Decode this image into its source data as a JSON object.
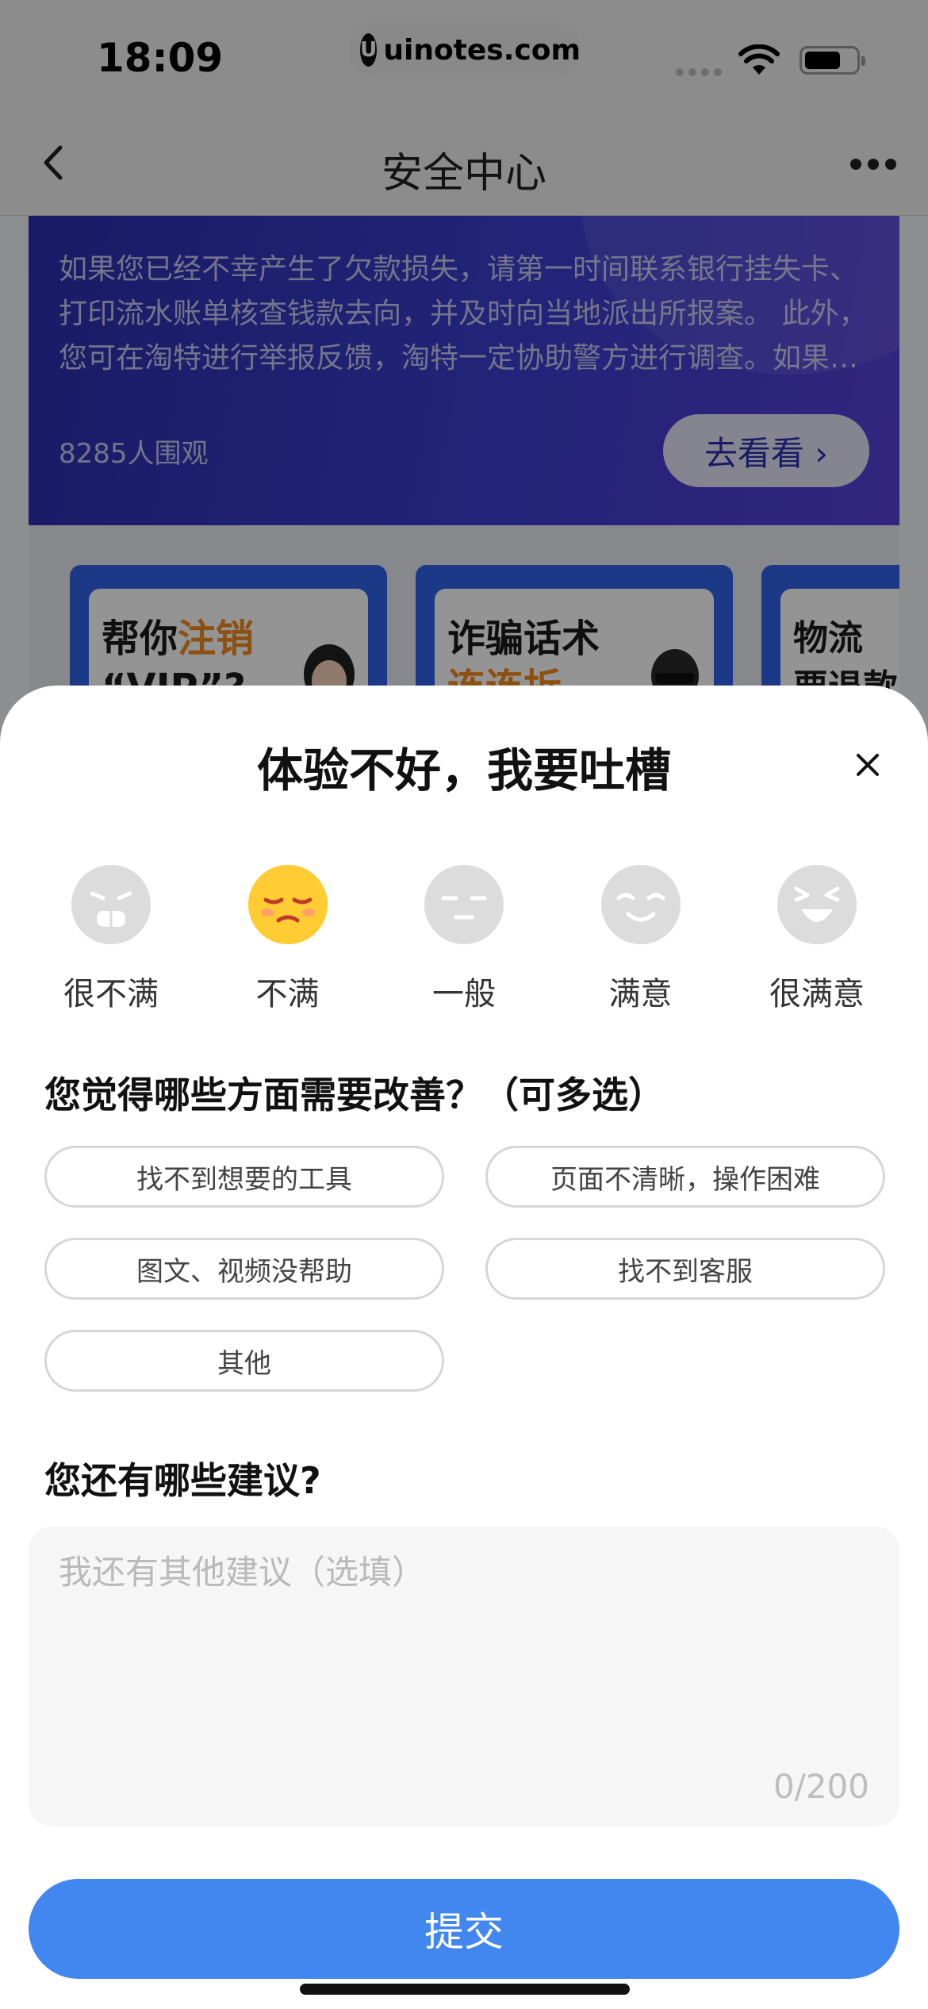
{
  "status_bar": {
    "time": "18:09",
    "url": "uinotes.com",
    "url_logo": "U"
  },
  "nav": {
    "title": "安全中心"
  },
  "promo": {
    "text": "如果您已经不幸产生了欠款损失，请第一时间联系银行挂失卡、打印流水账单核查钱款去向，并及时向当地派出所报案。 此外，您可在淘特进行举报反馈，淘特一定协助警方进行调查。如果…",
    "views": "8285人围观",
    "button_label": "去看看 ›"
  },
  "topic_cards": [
    {
      "line1_prefix": "帮你",
      "line1_highlight": "注销",
      "line2": "“VIP”?"
    },
    {
      "line1": "诈骗话术",
      "line2_highlight": "连连拆"
    },
    {
      "line1": "物流",
      "line2": "要退款"
    }
  ],
  "sheet": {
    "title": "体验不好，我要吐槽",
    "ratings": [
      {
        "label": "很不满",
        "icon": "very-unsatisfied-face-icon"
      },
      {
        "label": "不满",
        "icon": "unsatisfied-face-icon"
      },
      {
        "label": "一般",
        "icon": "neutral-face-icon"
      },
      {
        "label": "满意",
        "icon": "satisfied-face-icon"
      },
      {
        "label": "很满意",
        "icon": "very-satisfied-face-icon"
      }
    ],
    "selected_rating": "不满",
    "improve_title": "您觉得哪些方面需要改善？（可多选）",
    "options": [
      "找不到想要的工具",
      "页面不清晰，操作困难",
      "图文、视频没帮助",
      "找不到客服",
      "其他"
    ],
    "suggest_title": "您还有哪些建议?",
    "suggest_placeholder": "我还有其他建议（选填）",
    "suggest_value": "",
    "counter": "0/200",
    "submit_label": "提交"
  },
  "colors": {
    "accent": "#4286ef",
    "selected_face": "#ffcc33",
    "promo_bg": "#2d2fb0",
    "highlight": "#f28a1e"
  }
}
